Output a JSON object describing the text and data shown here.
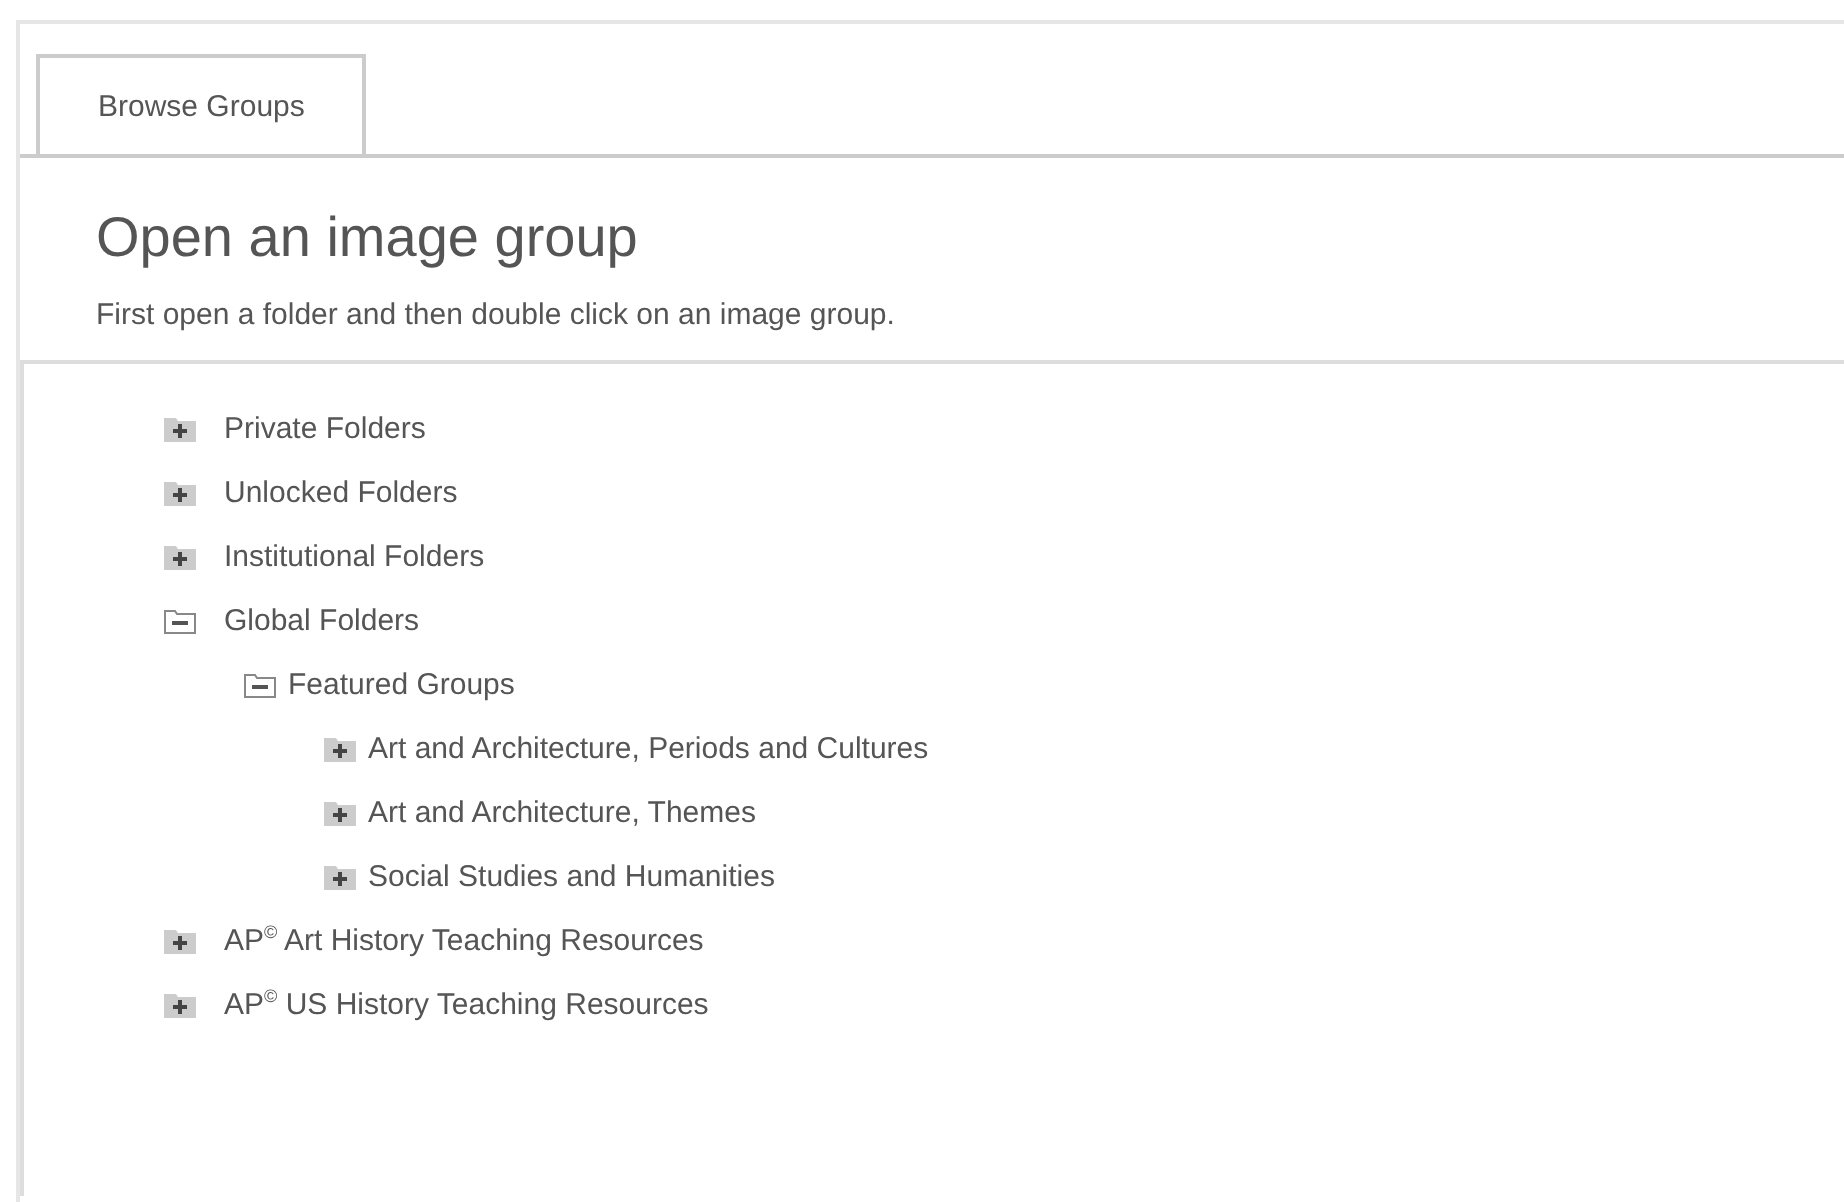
{
  "tabs": [
    {
      "label": "Browse Groups",
      "selected": true
    }
  ],
  "heading": "Open an image group",
  "instructions": "First open a folder and then double click on an image group.",
  "tree": [
    {
      "label": "Private Folders",
      "expanded": false
    },
    {
      "label": "Unlocked Folders",
      "expanded": false
    },
    {
      "label": "Institutional Folders",
      "expanded": false
    },
    {
      "label": "Global Folders",
      "expanded": true,
      "children": [
        {
          "label": "Featured Groups",
          "expanded": true,
          "children": [
            {
              "label": "Art and Architecture, Periods and Cultures",
              "expanded": false
            },
            {
              "label": "Art and Architecture, Themes",
              "expanded": false
            },
            {
              "label": "Social Studies and Humanities",
              "expanded": false
            }
          ]
        }
      ]
    },
    {
      "label": "AP$^{©}$ Art History Teaching Resources",
      "expanded": false
    },
    {
      "label": "AP$^{©}$ US History Teaching Resources",
      "expanded": false
    }
  ]
}
